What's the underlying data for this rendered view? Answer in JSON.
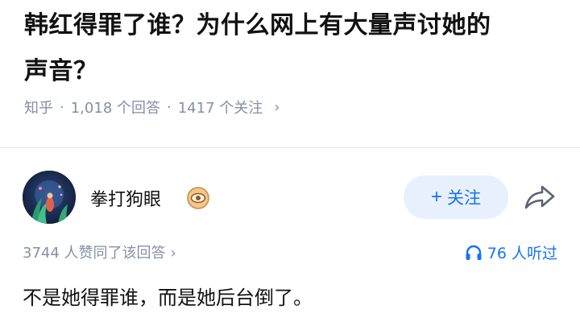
{
  "question": {
    "title_line1": "韩红得罪了谁？为什么网上有大量声讨她的",
    "title_line2": "声音？",
    "source": "知乎",
    "separator": "·",
    "answers": "1,018 个回答",
    "followers": "1417 个关注",
    "chevron": "›"
  },
  "author": {
    "name": "拳打狗眼",
    "follow_plus": "+",
    "follow_label": "关注"
  },
  "stats": {
    "votes": "3744 人赞同了该回答",
    "chevron": "›",
    "listens": "76 人听过"
  },
  "answer": {
    "text": "不是她得罪谁，而是她后台倒了。"
  },
  "colors": {
    "accent": "#1772f6",
    "follow_bg": "#e8f0fd",
    "meta": "#8590a6",
    "text": "#121212"
  }
}
